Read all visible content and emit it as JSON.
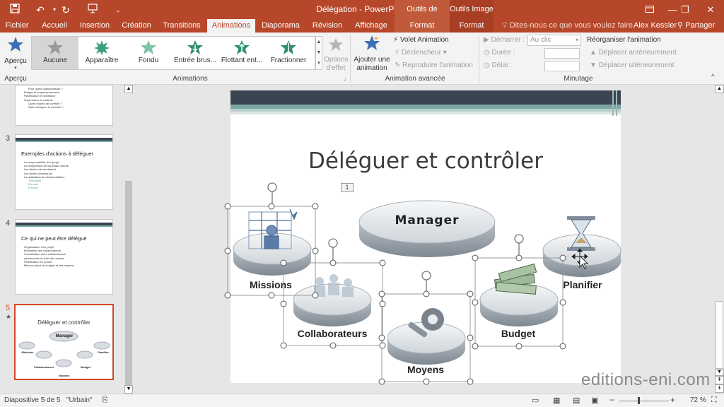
{
  "app": {
    "title": "Délégation - PowerPoint",
    "context_headers": [
      "Outils de dessin",
      "Outils Image"
    ],
    "user": "Alex Kessler",
    "share": "Partager",
    "tell_me": "Dites-nous ce que vous voulez faire."
  },
  "tabs": [
    "Fichier",
    "Accueil",
    "Insertion",
    "Création",
    "Transitions",
    "Animations",
    "Diaporama",
    "Révision",
    "Affichage"
  ],
  "context_tabs": [
    "Format",
    "Format"
  ],
  "ribbon": {
    "preview": {
      "label": "Aperçu",
      "group": "Aperçu"
    },
    "gallery": [
      "Aucune",
      "Apparaître",
      "Fondu",
      "Entrée brus...",
      "Flottant ent...",
      "Fractionner"
    ],
    "animations_group": "Animations",
    "effect_options": {
      "line1": "Options",
      "line2": "d'effet"
    },
    "add_animation": {
      "line1": "Ajouter une",
      "line2": "animation"
    },
    "animation_pane": "Volet Animation",
    "trigger": "Déclencheur",
    "painter": "Reproduire l'animation",
    "advanced_group": "Animation avancée",
    "start_label": "Démarrer :",
    "start_value": "Au clic",
    "duration_label": "Durée :",
    "delay_label": "Délai :",
    "reorder": "Réorganiser l'animation",
    "move_earlier": "Déplacer antérieurement",
    "move_later": "Déplacer ultérieurement",
    "timing_group": "Minutage"
  },
  "thumbs": [
    {
      "num": "",
      "lines": [
        "Pour quels collaborateurs ?",
        "Budget et moyens proposés",
        "Planification et échéance",
        "Supervision et contrôle",
        "Quels modes de contrôle ?",
        "Sait-il déléguer le contrôle ?"
      ]
    },
    {
      "num": "3",
      "title": "Exemples d'actions à déléguer",
      "lines": [
        "La responsabilité d'un projet",
        "La prospection de nouveaux clients",
        "Les tâches de secrétariat",
        "Les tâches techniques",
        "La réalisation de documentation :",
        "Technique",
        "De suivi",
        "D'étude"
      ]
    },
    {
      "num": "4",
      "title": "Ce qui ne peut être délégué",
      "lines": [
        "Organisation d'un projet",
        "Motivation des collaborateurs",
        "Coordination entre collaborateurs",
        "Ajustements et suivi des actions",
        "Planification en amont",
        "Mise en place du budget et des moyens"
      ]
    },
    {
      "num": "5",
      "title": "Déléguer et contrôler",
      "lines": []
    }
  ],
  "thumb5_labels": [
    "Manager",
    "Missions",
    "Planifier",
    "Collaborateurs",
    "Budget",
    "Moyens"
  ],
  "thumb5_star": "★",
  "slide": {
    "title": "Déléguer et contrôler",
    "anim_tag": "1",
    "manager": "Manager",
    "missions": "Missions",
    "collaborateurs": "Collaborateurs",
    "moyens": "Moyens",
    "budget": "Budget",
    "planifier": "Planifier"
  },
  "status": {
    "slide_info": "Diapositive 5 de 5",
    "theme": "\"Urbain\"",
    "zoom": "72 %"
  },
  "watermark": "editions-eni.com",
  "colors": {
    "accent": "#b7472a",
    "tab_text": "#b7472a",
    "slide_bar": "#3b4552",
    "teal": "#7aa7a5"
  }
}
